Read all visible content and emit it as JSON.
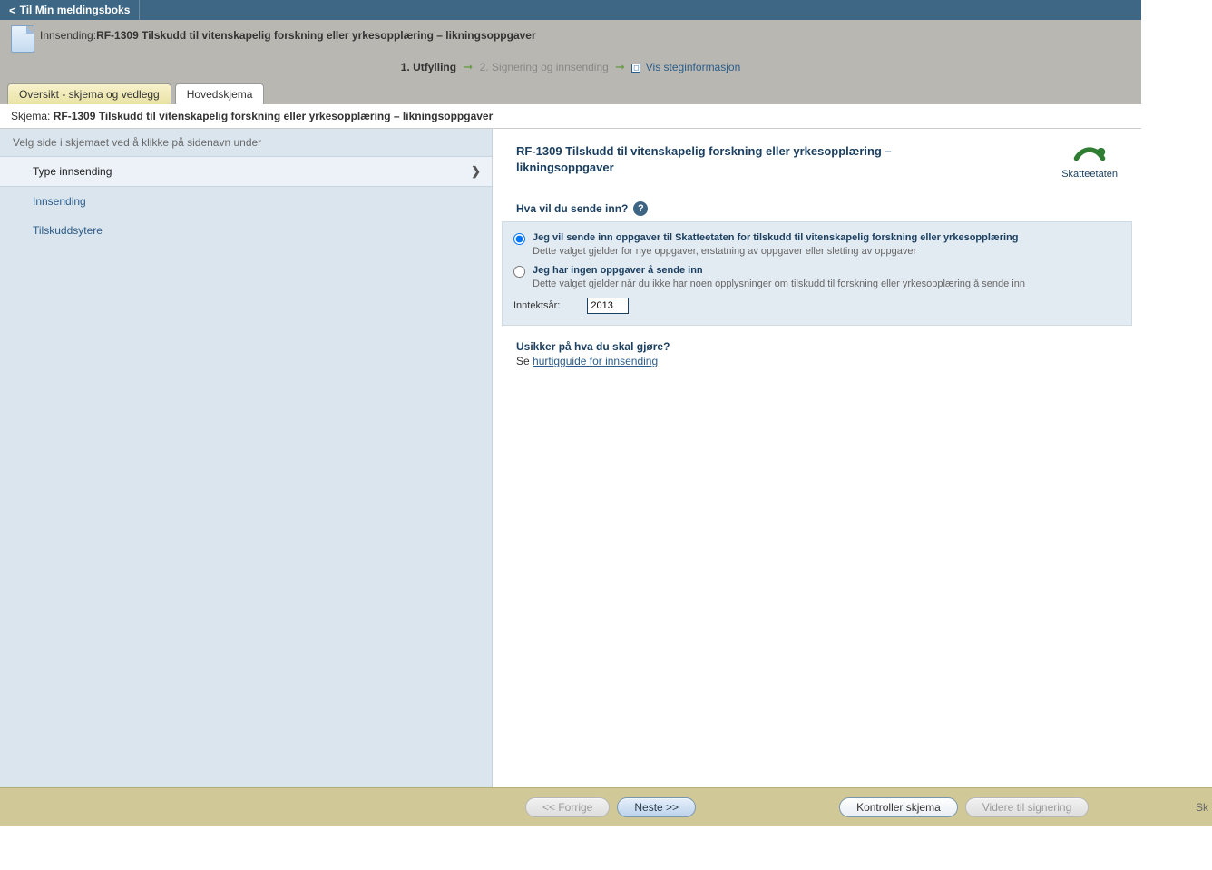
{
  "topbar": {
    "back_label": "Til Min meldingsboks"
  },
  "header": {
    "submit_prefix": "Innsending:",
    "form_title": "RF-1309 Tilskudd til vitenskapelig forskning eller yrkesopplæring – likningsoppgaver"
  },
  "steps": {
    "s1_num": "1.",
    "s1_label": "Utfylling",
    "s2_num": "2.",
    "s2_label": "Signering og innsending",
    "toggle_label": "Vis steginformasjon"
  },
  "tabs": {
    "overview": "Oversikt - skjema og vedlegg",
    "main": "Hovedskjema"
  },
  "schema": {
    "label": "Skjema:",
    "title": "RF-1309 Tilskudd til vitenskapelig forskning eller yrkesopplæring – likningsoppgaver"
  },
  "sidebar": {
    "header": "Velg side i skjemaet ved å klikke på sidenavn under",
    "items": [
      {
        "label": "Type innsending"
      },
      {
        "label": "Innsending"
      },
      {
        "label": "Tilskuddsytere"
      }
    ]
  },
  "form": {
    "title": "RF-1309 Tilskudd til vitenskapelig forskning eller yrkesopplæring – likningsoppgaver",
    "agency": "Skatteetaten",
    "question": "Hva vil du sende inn?",
    "opt1_title": "Jeg vil sende inn oppgaver til Skatteetaten for tilskudd til vitenskapelig forskning eller yrkesopplæring",
    "opt1_desc": "Dette valget gjelder for nye oppgaver, erstatning av oppgaver eller sletting av oppgaver",
    "opt2_title": "Jeg har ingen oppgaver å sende inn",
    "opt2_desc": "Dette valget gjelder når du ikke har noen opplysninger om tilskudd til forskning eller yrkesopplæring å sende inn",
    "year_label": "Inntektsår:",
    "year_value": "2013",
    "unsure": "Usikker på hva du skal gjøre?",
    "see_prefix": "Se",
    "see_link": "hurtigguide for innsending"
  },
  "footer": {
    "prev": "<< Forrige",
    "next": "Neste >>",
    "control": "Kontroller skjema",
    "sign": "Videre til signering",
    "right_tail": "Sk"
  }
}
